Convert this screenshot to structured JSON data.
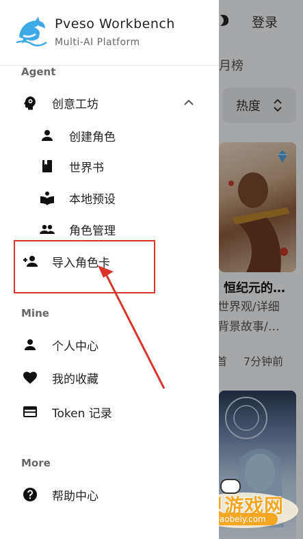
{
  "background": {
    "login_label": "登录",
    "tab_label": "月榜",
    "sort_label": "热度",
    "card1": {
      "title": "恒纪元的…",
      "desc_line1": "世界观/详细",
      "desc_line2": "背景故事/…",
      "meta_a": "首",
      "meta_b": "7分钟前"
    }
  },
  "drawer": {
    "brand_name": "Pveso Workbench",
    "brand_sub": "Multi-AI Platform",
    "sections": {
      "agent": "Agent",
      "mine": "Mine",
      "more": "More"
    },
    "agent_group": {
      "label": "创意工坊",
      "icon": "brain-gear-icon",
      "expanded": true,
      "children": [
        {
          "label": "创建角色",
          "icon": "person-icon"
        },
        {
          "label": "世界书",
          "icon": "book-icon"
        },
        {
          "label": "本地预设",
          "icon": "open-book-icon"
        },
        {
          "label": "角色管理",
          "icon": "people-icon"
        }
      ]
    },
    "import_item": {
      "label": "导入角色卡",
      "icon": "person-add-icon"
    },
    "mine_items": [
      {
        "label": "个人中心",
        "icon": "person-icon"
      },
      {
        "label": "我的收藏",
        "icon": "heart-icon"
      },
      {
        "label": "Token 记录",
        "icon": "card-icon"
      }
    ],
    "more_items": [
      {
        "label": "帮助中心",
        "icon": "help-icon"
      }
    ]
  },
  "watermark": {
    "text": "宝贝游戏网",
    "url": "baobeiy.com"
  },
  "colors": {
    "annotation_red": "#d9342b",
    "watermark_orange": "#f5a623"
  }
}
